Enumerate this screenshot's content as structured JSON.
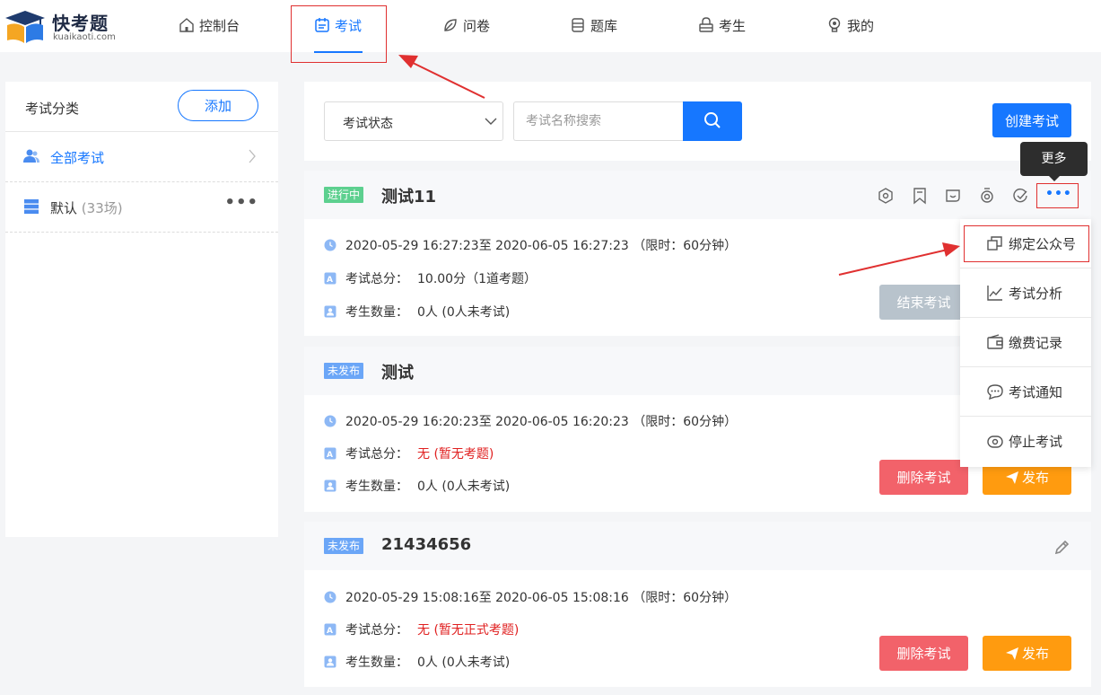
{
  "brand": {
    "name": "快考题",
    "domain": "kuaikaoti.com"
  },
  "nav": [
    {
      "label": "控制台",
      "icon": "home-icon"
    },
    {
      "label": "考试",
      "icon": "calendar-icon"
    },
    {
      "label": "问卷",
      "icon": "leaf-icon"
    },
    {
      "label": "题库",
      "icon": "database-icon"
    },
    {
      "label": "考生",
      "icon": "lock-icon"
    },
    {
      "label": "我的",
      "icon": "bulb-icon"
    }
  ],
  "sidebar": {
    "title": "考试分类",
    "add_label": "添加",
    "items": [
      {
        "label": "全部考试",
        "count": ""
      },
      {
        "label": "默认",
        "count": "(33场)"
      }
    ]
  },
  "toolbar": {
    "status_select": "考试状态",
    "search_placeholder": "考试名称搜索",
    "create_label": "创建考试"
  },
  "tooltip": "更多",
  "more_menu": [
    {
      "label": "绑定公众号",
      "icon": "copy-icon"
    },
    {
      "label": "考试分析",
      "icon": "chart-line-icon"
    },
    {
      "label": "缴费记录",
      "icon": "wallet-icon"
    },
    {
      "label": "考试通知",
      "icon": "chat-icon"
    },
    {
      "label": "停止考试",
      "icon": "stop-icon"
    }
  ],
  "exams": [
    {
      "status": "进行中",
      "title": "测试11",
      "time": "2020-05-29 16:27:23至 2020-06-05 16:27:23 （限时：60分钟）",
      "score_label": "考试总分：",
      "score": "10.00分（1道考题）",
      "count_label": "考生数量：",
      "count": "0人 (0人未考试)",
      "end_label": "结束考试"
    },
    {
      "status": "未发布",
      "title": "测试",
      "time": "2020-05-29 16:20:23至 2020-06-05 16:20:23 （限时：60分钟）",
      "score_label": "考试总分：",
      "score": "无 (暂无考题)",
      "count_label": "考生数量：",
      "count": "0人 (0人未考试)",
      "delete_label": "删除考试",
      "publish_label": "发布"
    },
    {
      "status": "未发布",
      "title": "21434656",
      "time": "2020-05-29 15:08:16至 2020-06-05 15:08:16 （限时：60分钟）",
      "score_label": "考试总分：",
      "score": "无 (暂无正式考题)",
      "count_label": "考生数量：",
      "count": "0人 (0人未考试)",
      "delete_label": "删除考试",
      "publish_label": "发布"
    }
  ],
  "colors": {
    "primary": "#1677ff",
    "danger": "#f2626a",
    "warning": "#ff9b0f",
    "success": "#5dd08f",
    "annotation": "#e03030"
  }
}
